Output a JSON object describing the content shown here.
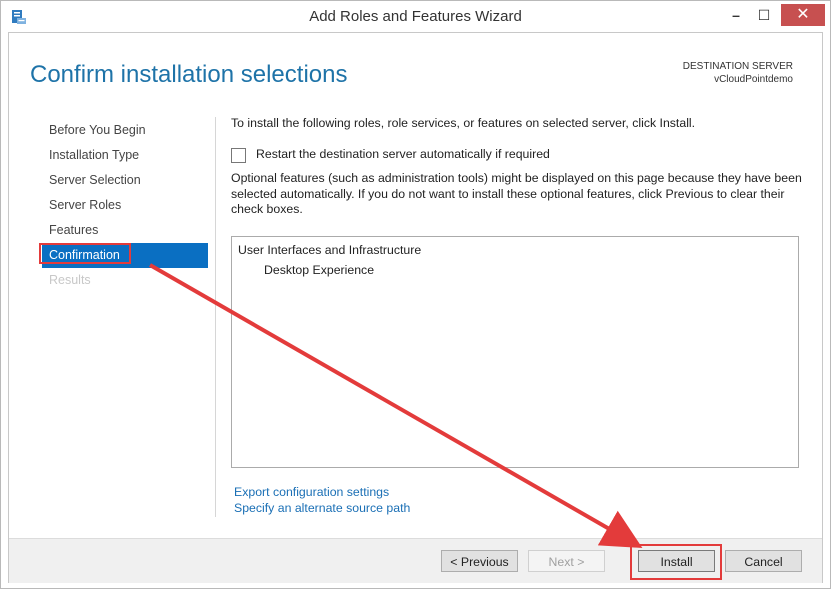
{
  "window": {
    "title": "Add Roles and Features Wizard",
    "minimize_glyph": "–",
    "maximize_glyph": "☐",
    "close_glyph": "✕"
  },
  "page": {
    "title": "Confirm installation selections",
    "destination_label": "DESTINATION SERVER",
    "destination_name": "vCloudPointdemo"
  },
  "nav": {
    "items": [
      {
        "label": "Before You Begin"
      },
      {
        "label": "Installation Type"
      },
      {
        "label": "Server Selection"
      },
      {
        "label": "Server Roles"
      },
      {
        "label": "Features"
      },
      {
        "label": "Confirmation"
      },
      {
        "label": "Results"
      }
    ]
  },
  "content": {
    "instruction": "To install the following roles, role services, or features on selected server, click Install.",
    "restart_label": "Restart the destination server automatically if required",
    "optional_note": "Optional features (such as administration tools) might be displayed on this page because they have been selected automatically. If you do not want to install these optional features, click Previous to clear their check boxes.",
    "features": {
      "category": "User Interfaces and Infrastructure",
      "item": "Desktop Experience"
    },
    "export_link": "Export configuration settings",
    "source_link": "Specify an alternate source path"
  },
  "footer": {
    "previous": "< Previous",
    "next": "Next >",
    "install": "Install",
    "cancel": "Cancel"
  },
  "colors": {
    "accent": "#0a6fc2",
    "title": "#1e73a8",
    "annotation_red": "#e33b3b"
  }
}
